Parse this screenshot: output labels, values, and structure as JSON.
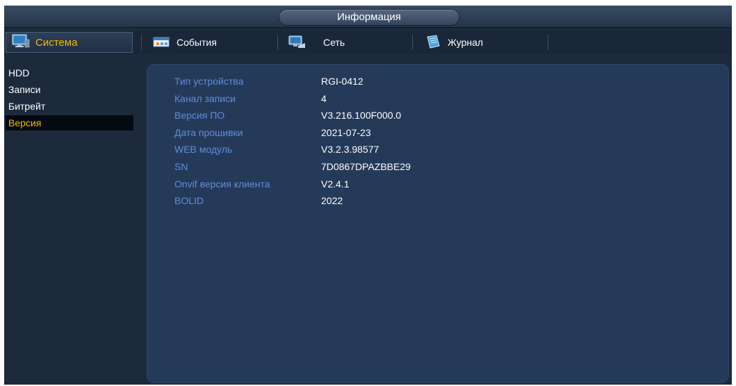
{
  "title": "Информация",
  "tabs": [
    {
      "label": "Система",
      "icon": "monitor-icon"
    },
    {
      "label": "События",
      "icon": "events-icon"
    },
    {
      "label": "Сеть",
      "icon": "network-icon"
    },
    {
      "label": "Журнал",
      "icon": "journal-icon"
    }
  ],
  "menu": {
    "items": [
      "HDD",
      "Записи",
      "Битрейт",
      "Версия"
    ],
    "active": "Версия"
  },
  "info": [
    {
      "label": "Тип устройства",
      "value": "RGI-0412"
    },
    {
      "label": "Канал записи",
      "value": "4"
    },
    {
      "label": "Версия ПО",
      "value": "V3.216.100F000.0"
    },
    {
      "label": "Дата прошивки",
      "value": "2021-07-23"
    },
    {
      "label": "WEB модуль",
      "value": "V3.2.3.98577"
    },
    {
      "label": "SN",
      "value": "7D0867DPAZBBE29"
    },
    {
      "label": "Onvif версия клиента",
      "value": "V2.4.1"
    },
    {
      "label": "BOLID",
      "value": "2022"
    }
  ],
  "colors": {
    "accent": "#f5b800",
    "label": "#5f8cdc",
    "panel": "#253a59",
    "background": "#1c2a3c"
  }
}
